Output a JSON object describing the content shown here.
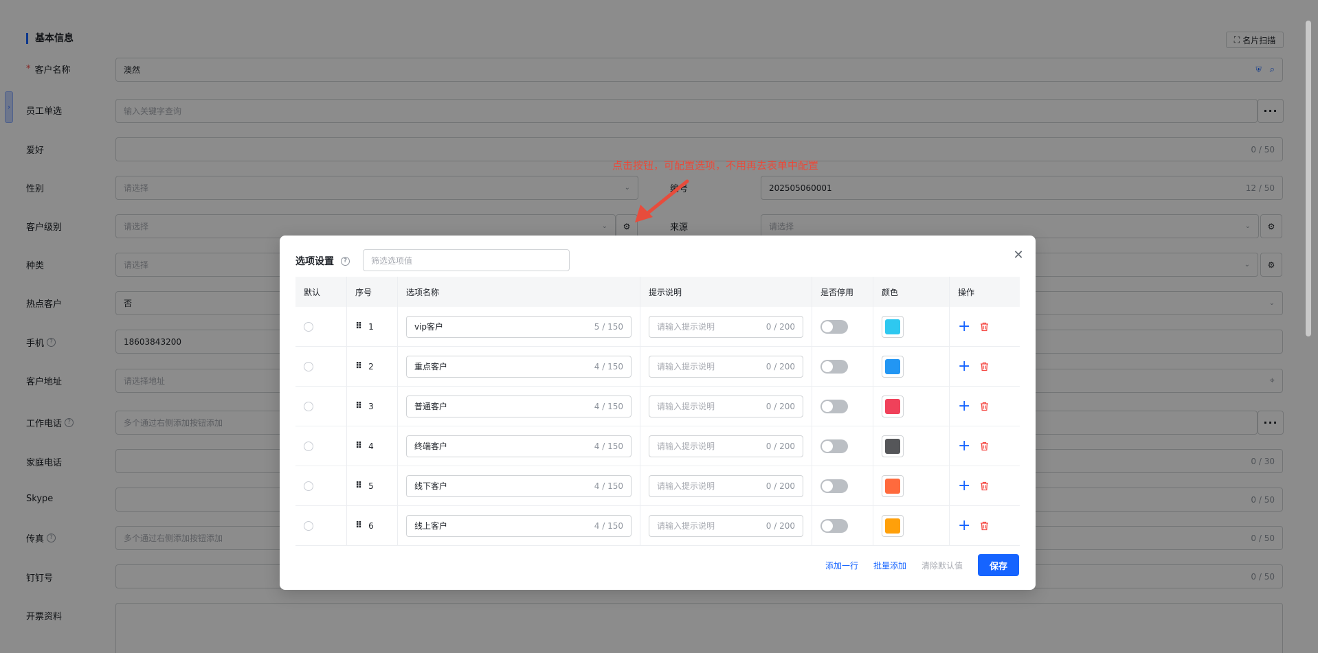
{
  "form": {
    "section_title": "基本信息",
    "scan_button": "名片扫描",
    "customer_name": {
      "label": "客户名称",
      "value": "澳然"
    },
    "employee": {
      "label": "员工单选",
      "placeholder": "输入关键字查询"
    },
    "hobby": {
      "label": "爱好",
      "count": "0 / 50"
    },
    "gender": {
      "label": "性别",
      "placeholder": "请选择"
    },
    "number": {
      "label": "编号",
      "value": "202505060001",
      "count": "12 / 50"
    },
    "level": {
      "label": "客户级别",
      "placeholder": "请选择"
    },
    "source": {
      "label": "来源",
      "placeholder": "请选择"
    },
    "category": {
      "label": "种类",
      "placeholder": "请选择"
    },
    "hot": {
      "label": "热点客户",
      "value": "否"
    },
    "mobile": {
      "label": "手机",
      "value": "18603843200"
    },
    "address": {
      "label": "客户地址",
      "placeholder": "请选择地址"
    },
    "work_phone": {
      "label": "工作电话",
      "placeholder": "多个通过右侧添加按钮添加"
    },
    "home_phone": {
      "label": "家庭电话",
      "count": "0 / 30"
    },
    "skype": {
      "label": "Skype",
      "count": "0 / 50"
    },
    "fax": {
      "label": "传真",
      "placeholder": "多个通过右侧添加按钮添加",
      "count": "0 / 50"
    },
    "dingtalk": {
      "label": "钉钉号",
      "count": "0 / 50"
    },
    "invoice": {
      "label": "开票资料"
    }
  },
  "annotation": "点击按钮，可配置选项，不用再去表单中配置",
  "dialog": {
    "title": "选项设置",
    "filter_placeholder": "筛选选项值",
    "columns": [
      "默认",
      "序号",
      "选项名称",
      "提示说明",
      "是否停用",
      "颜色",
      "操作"
    ],
    "tip_placeholder": "请输入提示说明",
    "rows": [
      {
        "seq": "1",
        "name": "vip客户",
        "name_count": "5 / 150",
        "tip_count": "0 / 200",
        "color": "#2ec8f0"
      },
      {
        "seq": "2",
        "name": "重点客户",
        "name_count": "4 / 150",
        "tip_count": "0 / 200",
        "color": "#2296f3"
      },
      {
        "seq": "3",
        "name": "普通客户",
        "name_count": "4 / 150",
        "tip_count": "0 / 200",
        "color": "#f0415a"
      },
      {
        "seq": "4",
        "name": "终端客户",
        "name_count": "4 / 150",
        "tip_count": "0 / 200",
        "color": "#555659"
      },
      {
        "seq": "5",
        "name": "线下客户",
        "name_count": "4 / 150",
        "tip_count": "0 / 200",
        "color": "#ff6a3d"
      },
      {
        "seq": "6",
        "name": "线上客户",
        "name_count": "4 / 150",
        "tip_count": "0 / 200",
        "color": "#ffa00a"
      }
    ],
    "footer": {
      "add_row": "添加一行",
      "batch_add": "批量添加",
      "clear_default": "清除默认值",
      "save": "保存"
    }
  }
}
